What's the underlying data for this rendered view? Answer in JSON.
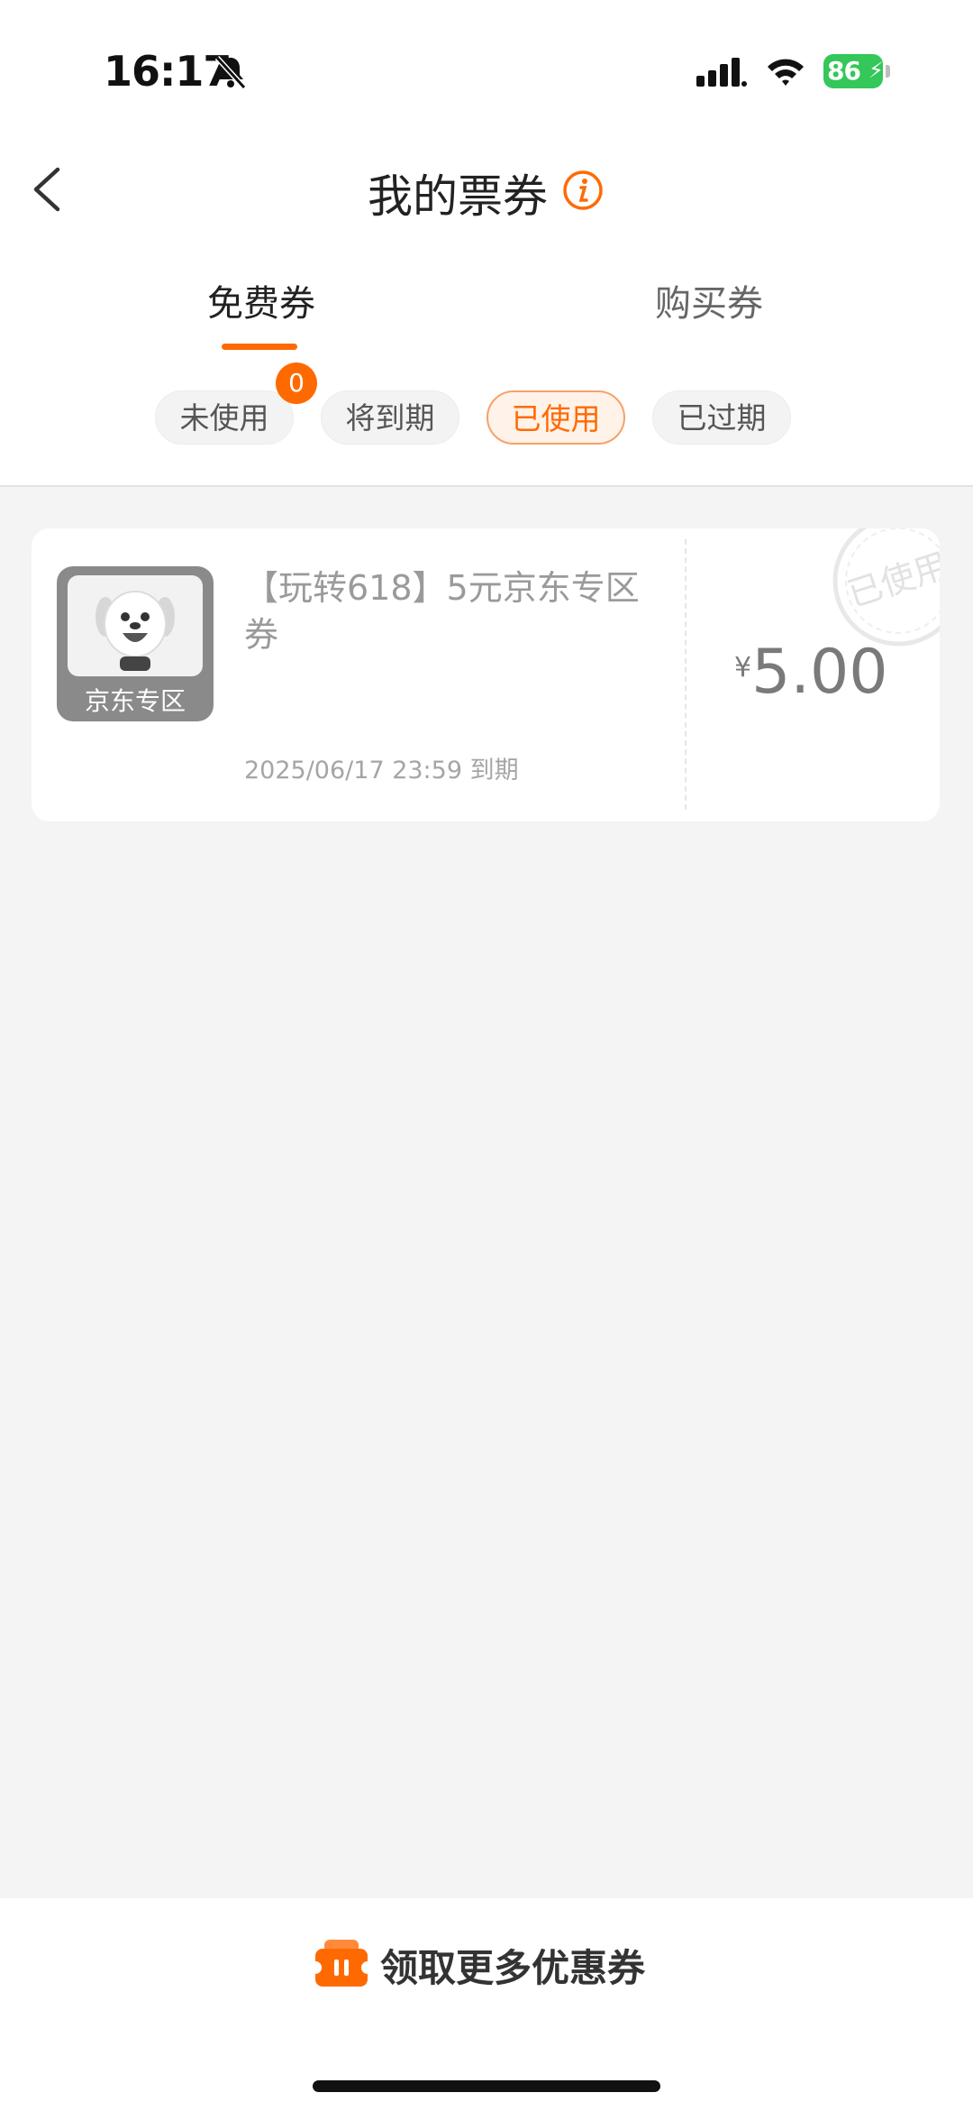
{
  "status_bar": {
    "time": "16:17",
    "battery": "86"
  },
  "header": {
    "title": "我的票券"
  },
  "tabs": [
    {
      "label": "免费券",
      "active": true
    },
    {
      "label": "购买券",
      "active": false
    }
  ],
  "filters": [
    {
      "label": "未使用"
    },
    {
      "label": "将到期"
    },
    {
      "label": "已使用",
      "active": true
    },
    {
      "label": "已过期"
    }
  ],
  "filter_badge": "0",
  "coupon": {
    "thumb_label": "京东专区",
    "title": "【玩转618】5元京东专区券",
    "expiry": "2025/06/17 23:59 到期",
    "currency": "¥",
    "amount": "5.00",
    "stamp": "已使用"
  },
  "bottom": {
    "label": "领取更多优惠券"
  },
  "colors": {
    "accent": "#ff6a00",
    "battery": "#34c759"
  }
}
